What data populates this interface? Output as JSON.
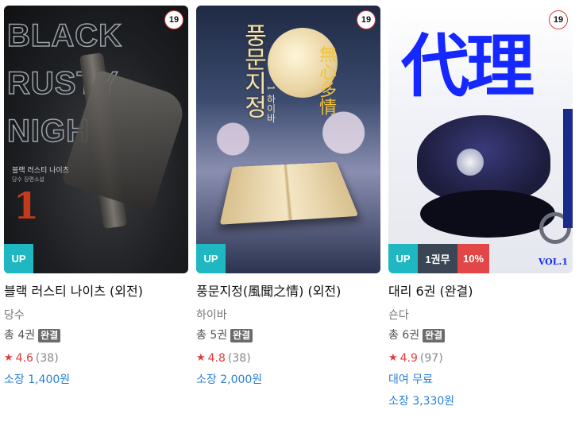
{
  "books": [
    {
      "title": "블랙 러스티 나이츠 (외전)",
      "author": "당수",
      "volumes": "총 4권",
      "status_badge": "완결",
      "age_rating": "19",
      "flags": {
        "up": "UP"
      },
      "rating": "4.6",
      "rating_count": "(38)",
      "prices": [
        "소장 1,400원"
      ],
      "cover_art": {
        "title_text": "BLACK\nRUSTY\nNIGHT",
        "subtitle": "블랙 러스티 나이츠",
        "author_line": "당수 장편소설",
        "number": "1"
      }
    },
    {
      "title": "풍문지정(風聞之情) (외전)",
      "author": "하이바",
      "volumes": "총 5권",
      "status_badge": "완결",
      "age_rating": "19",
      "flags": {
        "up": "UP"
      },
      "rating": "4.8",
      "rating_count": "(38)",
      "prices": [
        "소장 2,000원"
      ],
      "cover_art": {
        "title_text": "풍문지정",
        "hanja": "無心多情",
        "volume": "1 하이바"
      }
    },
    {
      "title": "대리 6권 (완결)",
      "author": "숀다",
      "volumes": "총 6권",
      "status_badge": "완결",
      "age_rating": "19",
      "flags": {
        "up": "UP",
        "free": "1권무",
        "discount": "10%"
      },
      "rating": "4.9",
      "rating_count": "(97)",
      "prices": [
        "대여 무료",
        "소장 3,330원"
      ],
      "cover_art": {
        "title_text": "代理",
        "volume": "VOL.1"
      }
    }
  ],
  "colors": {
    "up_flag": "#1fb7c2",
    "free_flag": "#3a4654",
    "discount_flag": "#e24646",
    "star": "#e13b3b",
    "price": "#2a7fd6",
    "age_border": "#e03a3a"
  },
  "icons": {
    "rating": "star-icon"
  }
}
